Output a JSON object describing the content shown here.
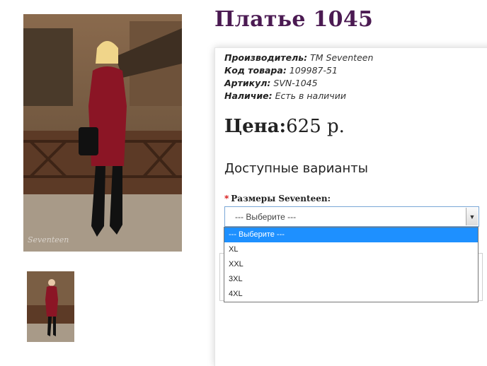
{
  "product": {
    "title": "Платье 1045",
    "images": {
      "main_alt": "",
      "watermark": "Seventeen"
    }
  },
  "specs": [
    {
      "label": "Производитель:",
      "value": "TM Seventeen"
    },
    {
      "label": "Код товара:",
      "value": "109987-51"
    },
    {
      "label": "Артикул:",
      "value": "SVN-1045"
    },
    {
      "label": "Наличие:",
      "value": "Есть в наличии"
    }
  ],
  "price": {
    "label": "Цена:",
    "value": "625 р."
  },
  "variants_heading": "Доступные варианты",
  "size_option": {
    "required_mark": "*",
    "label": "Размеры Seventeen:",
    "selected": "--- Выберите ---",
    "options": [
      "--- Выберите ---",
      "XL",
      "XXL",
      "3XL",
      "4XL"
    ],
    "highlighted_index": 0
  },
  "colors": {
    "title": "#4b1a52",
    "required": "#d40000",
    "highlight": "#1e90ff"
  }
}
